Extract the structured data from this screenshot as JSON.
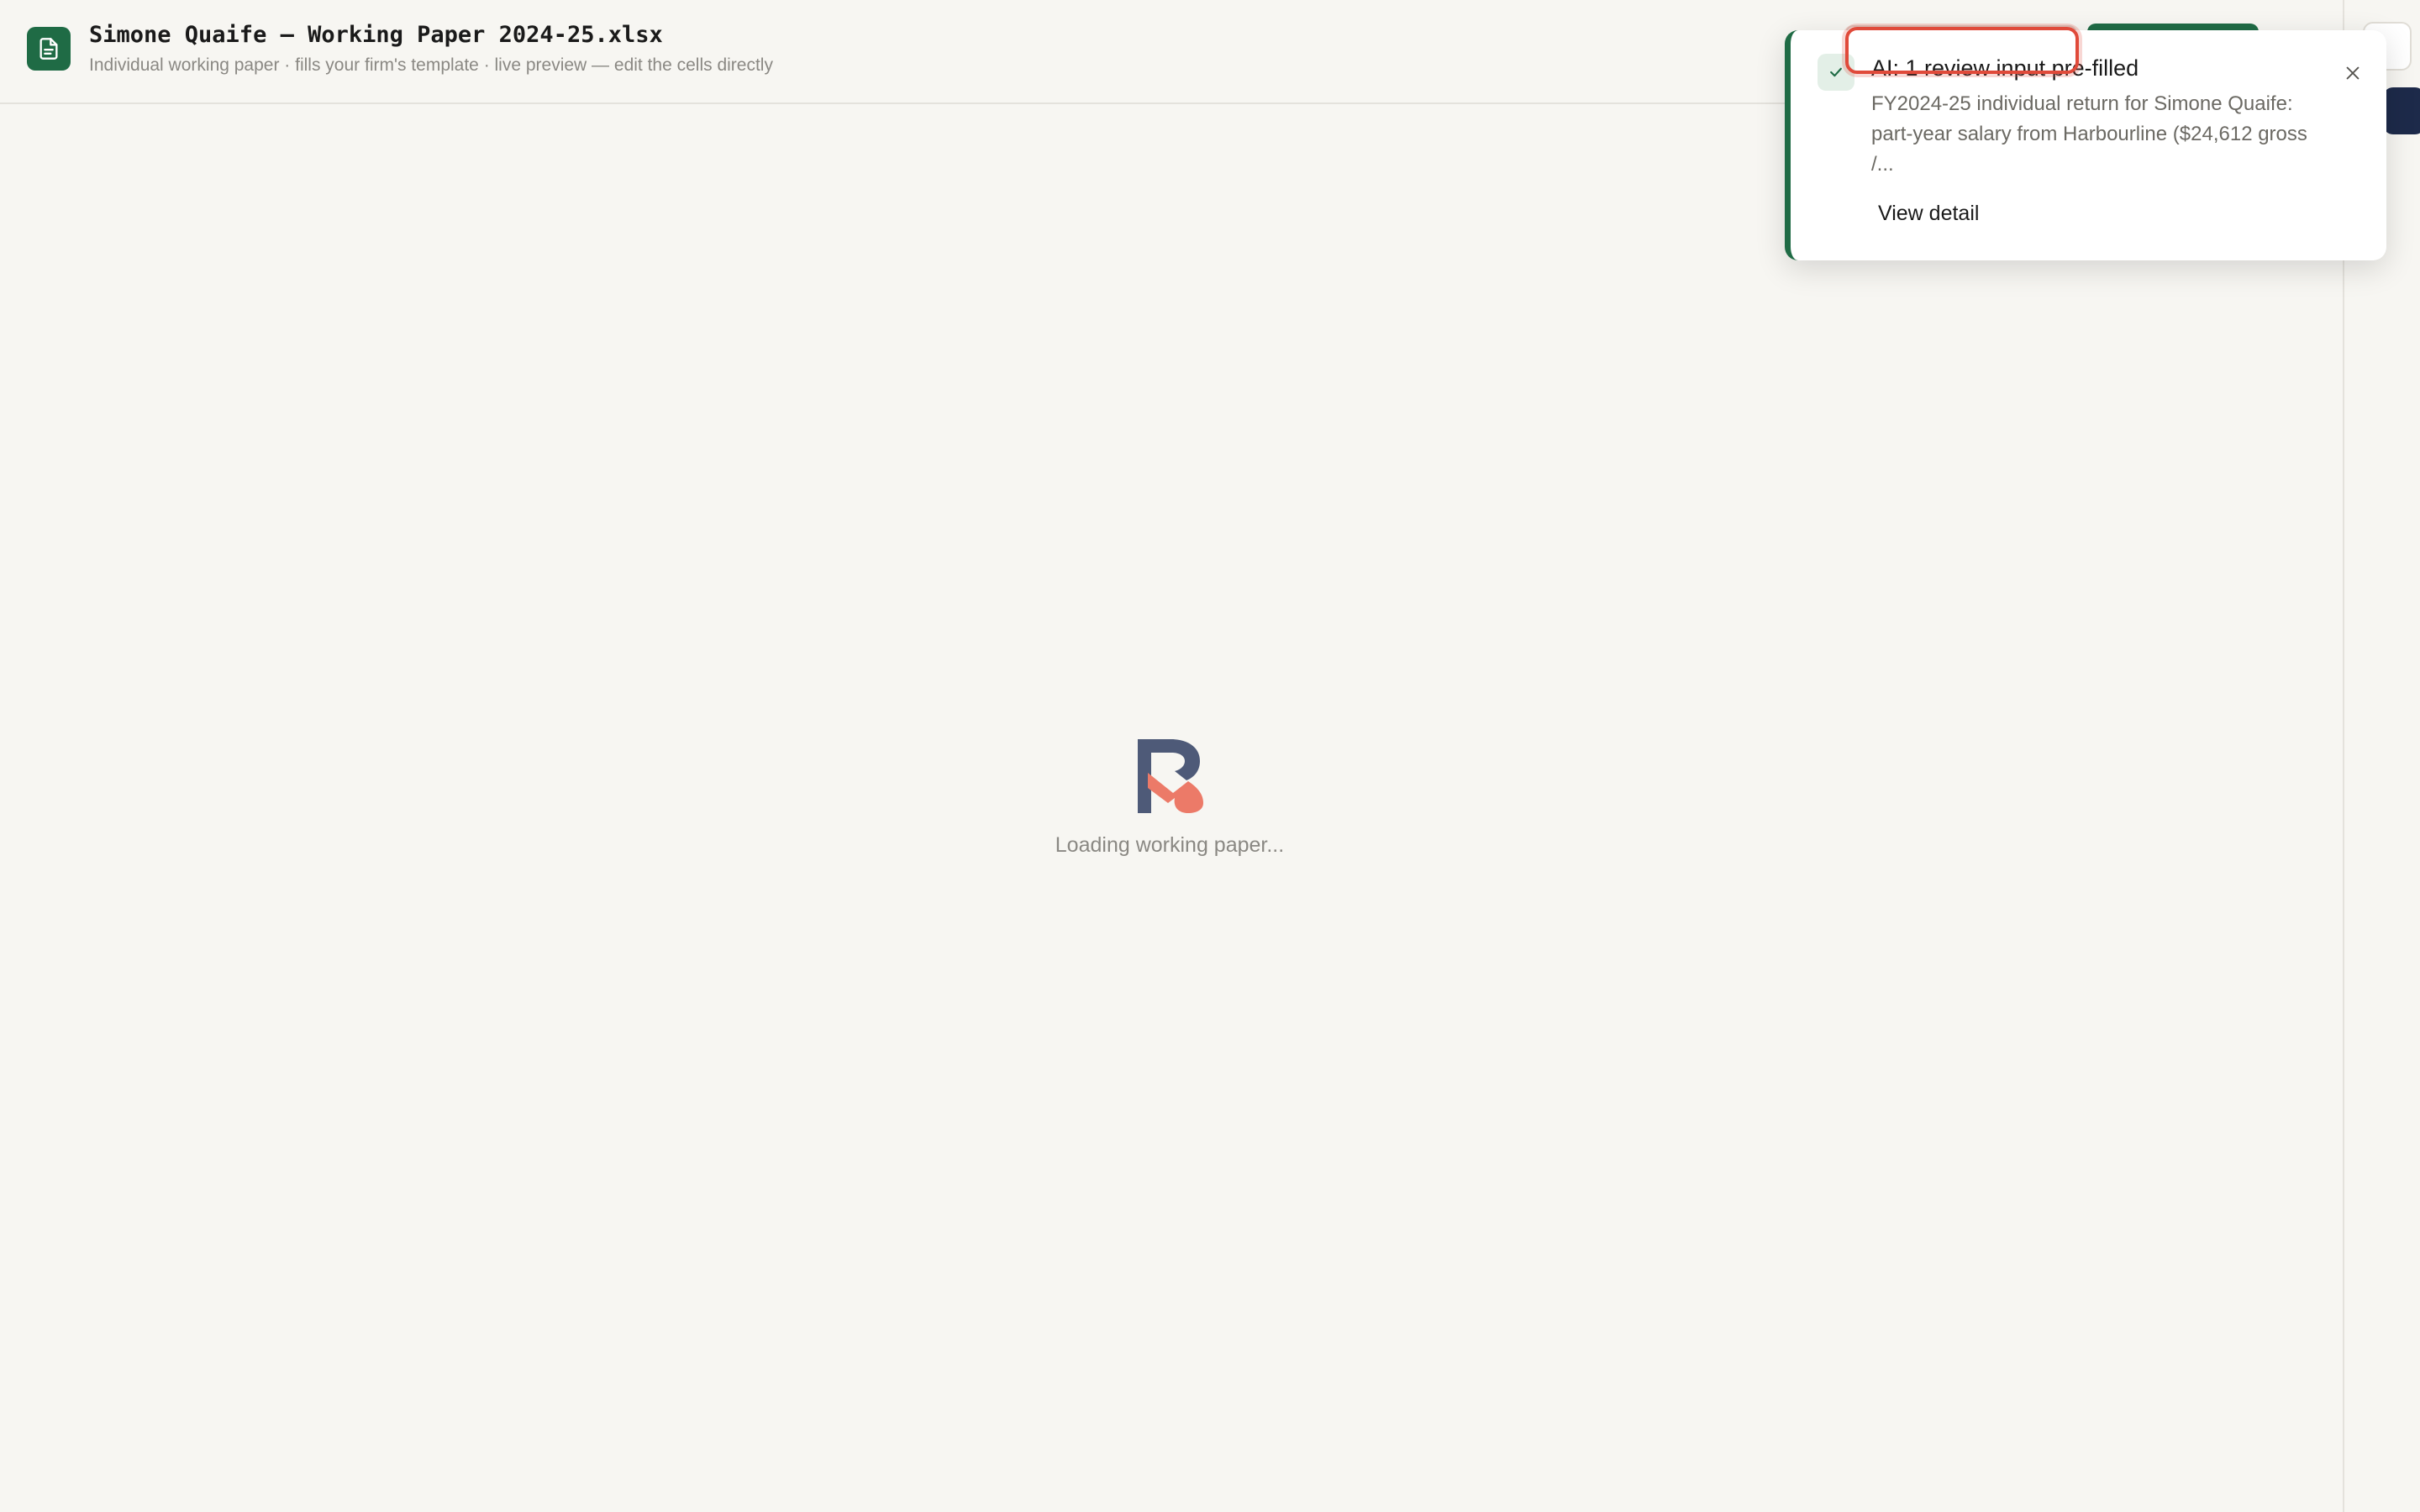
{
  "header": {
    "file_icon": "spreadsheet-document-icon",
    "title": "Simone Quaife — Working Paper 2024-25.xlsx",
    "subtitle": "Individual working paper · fills your firm's template · live preview — edit the cells directly"
  },
  "toast": {
    "icon": "check-icon",
    "title": "AI: 1 review input pre-filled",
    "body": "FY2024-25 individual return for Simone Quaife: part-year salary from Harbourline ($24,612 gross /...",
    "action_label": "View detail",
    "close_icon": "close-icon"
  },
  "main": {
    "logo_icon": "brand-logo-icon",
    "loading_text": "Loading working paper..."
  },
  "colors": {
    "brand_green": "#1f6b45",
    "background": "#f7f6f2",
    "highlight_red": "#e04a3a",
    "logo_slate": "#4e5a78",
    "logo_coral": "#ec7a68"
  }
}
